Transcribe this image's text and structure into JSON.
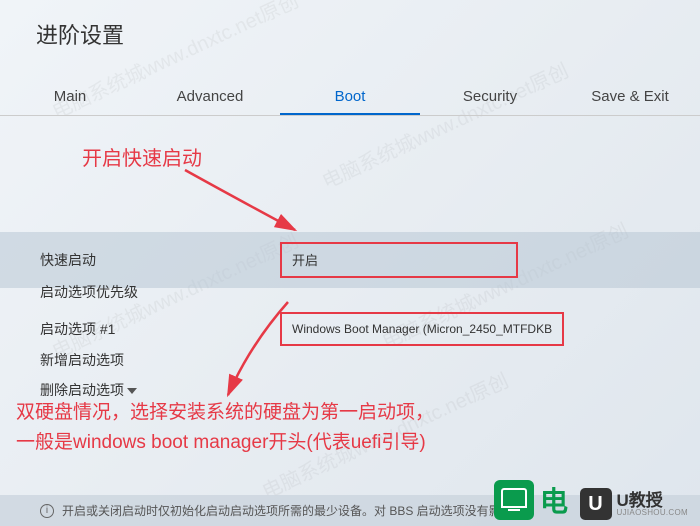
{
  "page_title": "进阶设置",
  "tabs": {
    "main": "Main",
    "advanced": "Advanced",
    "boot": "Boot",
    "security": "Security",
    "save_exit": "Save & Exit"
  },
  "annotation1": "开启快速启动",
  "annotation2_line1": "双硬盘情况，选择安装系统的硬盘为第一启动项，",
  "annotation2_line2": "一般是windows boot manager开头(代表uefi引导)",
  "rows": {
    "fast_boot_label": "快速启动",
    "fast_boot_value": "开启",
    "boot_priority_label": "启动选项优先级",
    "boot_option1_label": "启动选项 #1",
    "boot_option1_value": "Windows Boot Manager (Micron_2450_MTFDKB",
    "add_boot_label": "新增启动选项",
    "delete_boot_label": "删除启动选项"
  },
  "hint_text": "开启或关闭启动时仅初始化启动启动选项所需的最少设备。对 BBS 启动选项没有影响。",
  "logo_d": "电",
  "logo_u_main": "U教授",
  "logo_u_sub": "UJIAOSHOU.COM",
  "watermark_text": "电脑系统城www.dnxtc.net原创"
}
